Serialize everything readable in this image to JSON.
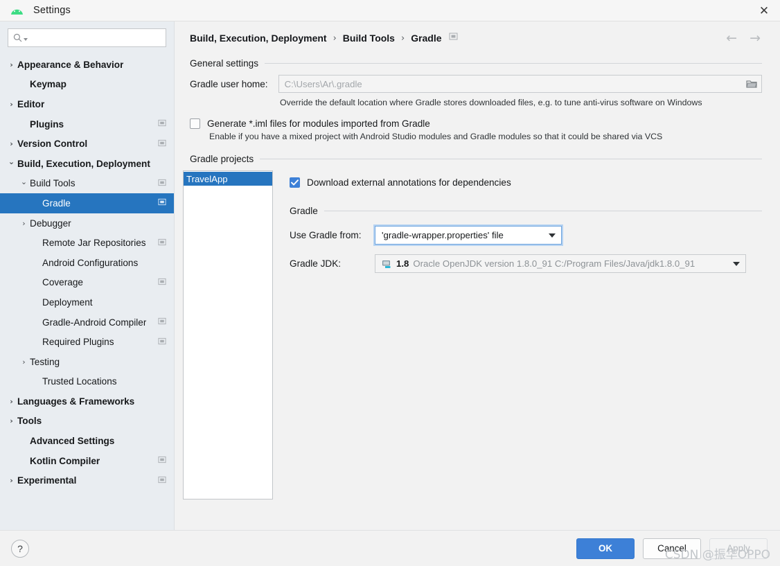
{
  "window": {
    "title": "Settings",
    "logo_icon": "android-studio-logo",
    "close_icon": "close-icon"
  },
  "search": {
    "value": "",
    "placeholder": "",
    "icon": "search-icon"
  },
  "sidebar": {
    "items": [
      {
        "label": "Appearance & Behavior",
        "indent": 0,
        "bold": true,
        "twisty": "collapsed",
        "scope": false,
        "selected": false
      },
      {
        "label": "Keymap",
        "indent": 1,
        "bold": true,
        "twisty": "none",
        "scope": false,
        "selected": false
      },
      {
        "label": "Editor",
        "indent": 0,
        "bold": true,
        "twisty": "collapsed",
        "scope": false,
        "selected": false
      },
      {
        "label": "Plugins",
        "indent": 1,
        "bold": true,
        "twisty": "none",
        "scope": true,
        "selected": false
      },
      {
        "label": "Version Control",
        "indent": 0,
        "bold": true,
        "twisty": "collapsed",
        "scope": true,
        "selected": false
      },
      {
        "label": "Build, Execution, Deployment",
        "indent": 0,
        "bold": true,
        "twisty": "expanded",
        "scope": false,
        "selected": false
      },
      {
        "label": "Build Tools",
        "indent": 1,
        "bold": false,
        "twisty": "expanded",
        "scope": true,
        "selected": false
      },
      {
        "label": "Gradle",
        "indent": 2,
        "bold": false,
        "twisty": "none",
        "scope": true,
        "selected": true
      },
      {
        "label": "Debugger",
        "indent": 1,
        "bold": false,
        "twisty": "collapsed",
        "scope": false,
        "selected": false
      },
      {
        "label": "Remote Jar Repositories",
        "indent": 2,
        "bold": false,
        "twisty": "none",
        "scope": true,
        "selected": false
      },
      {
        "label": "Android Configurations",
        "indent": 2,
        "bold": false,
        "twisty": "none",
        "scope": false,
        "selected": false
      },
      {
        "label": "Coverage",
        "indent": 2,
        "bold": false,
        "twisty": "none",
        "scope": true,
        "selected": false
      },
      {
        "label": "Deployment",
        "indent": 2,
        "bold": false,
        "twisty": "none",
        "scope": false,
        "selected": false
      },
      {
        "label": "Gradle-Android Compiler",
        "indent": 2,
        "bold": false,
        "twisty": "none",
        "scope": true,
        "selected": false
      },
      {
        "label": "Required Plugins",
        "indent": 2,
        "bold": false,
        "twisty": "none",
        "scope": true,
        "selected": false
      },
      {
        "label": "Testing",
        "indent": 1,
        "bold": false,
        "twisty": "collapsed",
        "scope": false,
        "selected": false
      },
      {
        "label": "Trusted Locations",
        "indent": 2,
        "bold": false,
        "twisty": "none",
        "scope": false,
        "selected": false
      },
      {
        "label": "Languages & Frameworks",
        "indent": 0,
        "bold": true,
        "twisty": "collapsed",
        "scope": false,
        "selected": false
      },
      {
        "label": "Tools",
        "indent": 0,
        "bold": true,
        "twisty": "collapsed",
        "scope": false,
        "selected": false
      },
      {
        "label": "Advanced Settings",
        "indent": 1,
        "bold": true,
        "twisty": "none",
        "scope": false,
        "selected": false
      },
      {
        "label": "Kotlin Compiler",
        "indent": 1,
        "bold": true,
        "twisty": "none",
        "scope": true,
        "selected": false
      },
      {
        "label": "Experimental",
        "indent": 0,
        "bold": true,
        "twisty": "collapsed",
        "scope": true,
        "selected": false
      }
    ]
  },
  "header": {
    "breadcrumb": [
      "Build, Execution, Deployment",
      "Build Tools",
      "Gradle"
    ],
    "separator": "›",
    "scope_icon": "project-scope-icon",
    "back_icon": "←",
    "forward_icon": "→"
  },
  "general": {
    "section_title": "General settings",
    "gradle_user_home": {
      "label": "Gradle user home:",
      "value": "",
      "placeholder": "C:\\Users\\Ar\\.gradle",
      "browse_icon": "folder-icon"
    },
    "hint_user_home": "Override the default location where Gradle stores downloaded files, e.g. to tune anti-virus software on Windows",
    "generate_iml": {
      "label": "Generate *.iml files for modules imported from Gradle",
      "checked": false
    },
    "hint_generate_iml": "Enable if you have a mixed project with Android Studio modules and Gradle modules so that it could be shared via VCS"
  },
  "projects": {
    "section_title": "Gradle projects",
    "list": [
      {
        "label": "TravelApp",
        "selected": true
      }
    ],
    "download_annotations": {
      "label": "Download external annotations for dependencies",
      "checked": true
    },
    "gradle_sub_title": "Gradle",
    "use_gradle_from": {
      "label": "Use Gradle from:",
      "value": "'gradle-wrapper.properties' file",
      "focused": true
    },
    "gradle_jdk": {
      "label": "Gradle JDK:",
      "icon": "jdk-icon",
      "version": "1.8",
      "detail": "Oracle OpenJDK version 1.8.0_91 C:/Program Files/Java/jdk1.8.0_91",
      "disabled": true
    }
  },
  "footer": {
    "help_label": "?",
    "ok_label": "OK",
    "cancel_label": "Cancel",
    "apply_label": "Apply",
    "apply_disabled": true
  },
  "watermark": "CSDN @振华OPPO",
  "colors": {
    "accent_blue": "#3d80d7",
    "selection_blue": "#2675bf",
    "sidebar_bg": "#e9edf1",
    "content_bg": "#f2f2f2"
  }
}
